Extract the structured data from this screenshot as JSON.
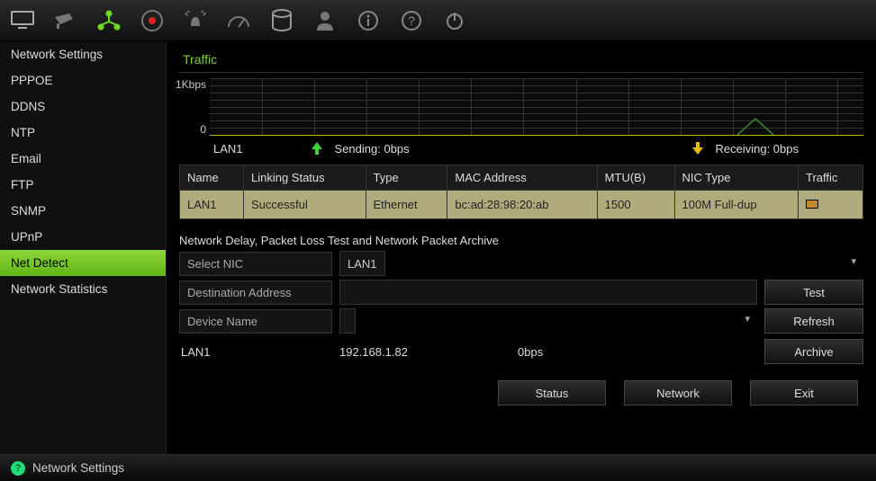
{
  "topbar": {
    "icons": [
      "monitor-icon",
      "camera-icon",
      "network-icon",
      "record-icon",
      "alarm-icon",
      "dashboard-icon",
      "hdd-icon",
      "user-icon",
      "info-icon",
      "help-icon",
      "power-icon"
    ],
    "active_index": 2
  },
  "sidebar": {
    "items": [
      {
        "label": "Network Settings"
      },
      {
        "label": "PPPOE"
      },
      {
        "label": "DDNS"
      },
      {
        "label": "NTP"
      },
      {
        "label": "Email"
      },
      {
        "label": "FTP"
      },
      {
        "label": "SNMP"
      },
      {
        "label": "UPnP"
      },
      {
        "label": "Net Detect"
      },
      {
        "label": "Network Statistics"
      }
    ],
    "active_index": 8
  },
  "traffic": {
    "title": "Traffic",
    "y_top": "1Kbps",
    "y_bottom": "0",
    "interface_label": "LAN1",
    "sending_label": "Sending: 0bps",
    "receiving_label": "Receiving: 0bps"
  },
  "nic_table": {
    "headers": [
      "Name",
      "Linking Status",
      "Type",
      "MAC Address",
      "MTU(B)",
      "NIC Type",
      "Traffic"
    ],
    "rows": [
      {
        "name": "LAN1",
        "status": "Successful",
        "type": "Ethernet",
        "mac": "bc:ad:28:98:20:ab",
        "mtu": "1500",
        "nictype": "100M Full-dup",
        "traffic_icon": "chart-icon"
      }
    ]
  },
  "test": {
    "header": "Network Delay, Packet Loss Test and Network Packet Archive",
    "select_nic_label": "Select NIC",
    "select_nic_value": "LAN1",
    "dest_label": "Destination Address",
    "dest_value": "",
    "device_label": "Device Name",
    "device_value": "",
    "btn_test": "Test",
    "btn_refresh": "Refresh",
    "btn_archive": "Archive",
    "status_if": "LAN1",
    "status_ip": "192.168.1.82",
    "status_rate": "0bps"
  },
  "bottom": {
    "status": "Status",
    "network": "Network",
    "exit": "Exit"
  },
  "statusbar": {
    "text": "Network Settings"
  },
  "chart_data": {
    "type": "line",
    "title": "Traffic",
    "series": [
      {
        "name": "Sending",
        "current": "0bps",
        "color": "#3bd13b"
      },
      {
        "name": "Receiving",
        "current": "0bps",
        "color": "#e6c000"
      }
    ],
    "ylabel": "",
    "ylim_label_top": "1Kbps",
    "ylim_label_bottom": "0",
    "note": "Mostly zero traffic; a single small receiving spike near the right side of the window."
  }
}
